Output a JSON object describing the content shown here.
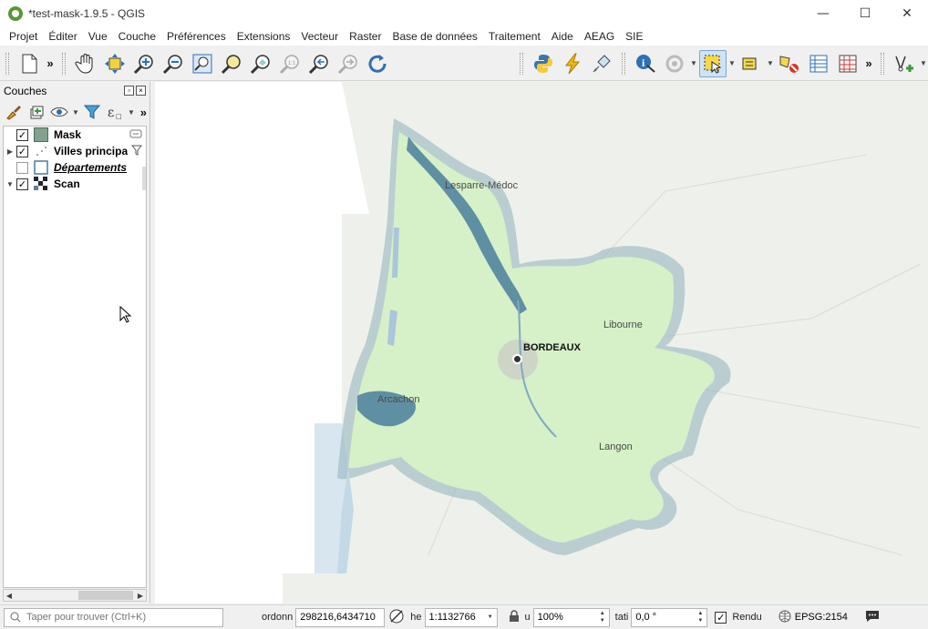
{
  "window": {
    "title": "*test-mask-1.9.5 - QGIS",
    "minimize": "—",
    "maximize": "☐",
    "close": "✕"
  },
  "menu": [
    "Projet",
    "Éditer",
    "Vue",
    "Couche",
    "Préférences",
    "Extensions",
    "Vecteur",
    "Raster",
    "Base de données",
    "Traitement",
    "Aide",
    "AEAG",
    "SIE"
  ],
  "toolbar": {
    "more": "»",
    "icons": [
      "new-project-icon",
      "pan-icon",
      "pan-to-selection-icon",
      "zoom-in-icon",
      "zoom-out-icon",
      "zoom-full-icon",
      "zoom-selection-icon",
      "zoom-layer-icon",
      "zoom-native-icon",
      "zoom-last-icon",
      "zoom-next-icon",
      "refresh-icon",
      "python-icon",
      "processing-icon",
      "plugin-icon",
      "identify-icon",
      "action-icon",
      "select-features-icon",
      "select-by-value-icon",
      "deselect-icon",
      "attribute-table-icon",
      "statistics-icon",
      "digitize-icon"
    ]
  },
  "layers_panel": {
    "title": "Couches",
    "more": "»",
    "layers": [
      {
        "name": "Mask",
        "checked": true,
        "expanded": null,
        "style": "bold",
        "symbol": "polygon-fill"
      },
      {
        "name": "Villes principa",
        "checked": true,
        "expanded": false,
        "style": "bold",
        "symbol": "point"
      },
      {
        "name": "Départements",
        "checked": false,
        "expanded": null,
        "style": "italic-underline",
        "symbol": "polygon-outline"
      },
      {
        "name": "Scan",
        "checked": true,
        "expanded": true,
        "style": "bold",
        "symbol": "raster"
      }
    ]
  },
  "map": {
    "labels": [
      {
        "text": "Lesparre-Médoc",
        "bold": false
      },
      {
        "text": "BORDEAUX",
        "bold": true
      },
      {
        "text": "Libourne",
        "bold": false
      },
      {
        "text": "Arcachon",
        "bold": false
      },
      {
        "text": "Langon",
        "bold": false
      }
    ],
    "colors": {
      "land": "#d6f0c8",
      "outside": "#eef0ea",
      "water": "#a9c6dc",
      "halo": "#5f8fa3"
    }
  },
  "statusbar": {
    "search_placeholder": "Taper pour trouver (Ctrl+K)",
    "coord_label": "ordonn",
    "coord_value": "298216,6434710",
    "scale_label": "he",
    "scale_value": "1:1132766",
    "magnifier_label": "u",
    "magnifier_value": "100%",
    "rotation_label": "tati",
    "rotation_value": "0,0 °",
    "render_label": "Rendu",
    "render_checked": true,
    "crs": "EPSG:2154"
  }
}
